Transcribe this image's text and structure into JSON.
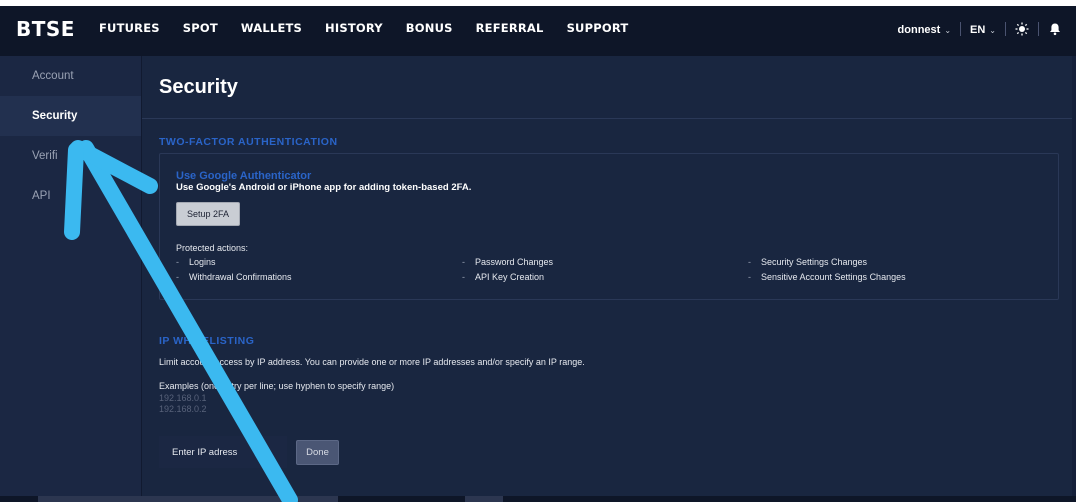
{
  "brand": "BTSE",
  "nav": [
    "FUTURES",
    "SPOT",
    "WALLETS",
    "HISTORY",
    "BONUS",
    "REFERRAL",
    "SUPPORT"
  ],
  "header_right": {
    "user": "donnest",
    "language": "EN",
    "user_caret": "⌄",
    "lang_caret": "⌄"
  },
  "sidebar": [
    {
      "label": "Account",
      "active": false
    },
    {
      "label": "Security",
      "active": true
    },
    {
      "label": "Verifi",
      "active": false
    },
    {
      "label": "API",
      "active": false
    }
  ],
  "page_title": "Security",
  "two_factor": {
    "section_title": "TWO-FACTOR AUTHENTICATION",
    "link": "Use Google Authenticator",
    "description": "Use Google's Android or iPhone app for adding token-based 2FA.",
    "button": "Setup 2FA",
    "protected_label": "Protected actions:",
    "dash": "-",
    "protected_actions": [
      "Logins",
      "Withdrawal Confirmations",
      "Password Changes",
      "API Key Creation",
      "Security Settings Changes",
      "Sensitive Account Settings Changes"
    ]
  },
  "ip_whitelisting": {
    "section_title": "IP WHITELISTING",
    "description": "Limit account access by IP address. You can provide one or more IP addresses and/or specify an IP range.",
    "examples": "Examples (one entry per line; use hyphen to specify range)",
    "sample_1": "192.168.0.1",
    "sample_2": "192.168.0.2",
    "input_placeholder": "Enter IP adress",
    "button": "Done"
  },
  "colors": {
    "background": "#15203a",
    "topnav": "#0e1628",
    "accent_blue": "#2a64c8",
    "annotation_arrow": "#3bb9f0"
  },
  "icons": [
    "sun-icon",
    "bell-icon",
    "annotation-arrow"
  ]
}
